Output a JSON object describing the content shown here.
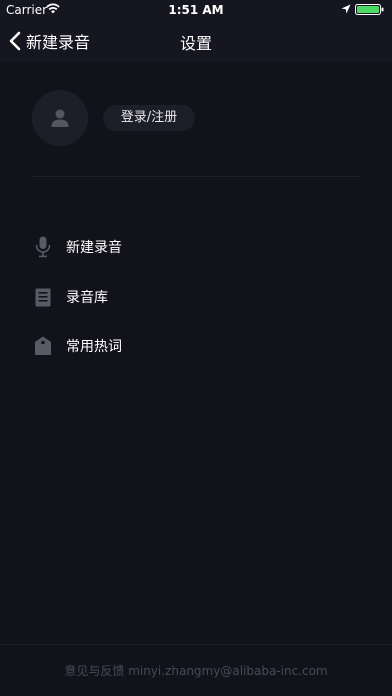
{
  "status_bar": {
    "carrier": "Carrier",
    "time": "1:51 AM",
    "icons": [
      "wifi-icon",
      "location-icon",
      "battery-icon"
    ],
    "battery_color": "#4cd964"
  },
  "nav": {
    "back_label": "新建录音",
    "title": "设置"
  },
  "profile": {
    "avatar_icon": "user-icon",
    "login_label": "登录/注册"
  },
  "menu": {
    "items": [
      {
        "label": "新建录音",
        "icon": "microphone-icon"
      },
      {
        "label": "录音库",
        "icon": "document-icon"
      },
      {
        "label": "常用热词",
        "icon": "tag-icon"
      }
    ]
  },
  "footer": {
    "text": "意见与反馈 minyi.zhangmy@alibaba-inc.com"
  },
  "colors": {
    "background": "#12121b",
    "bar_background": "#161620",
    "surface": "#1e1e28",
    "icon_gray": "#5a5a66",
    "footer_text": "#4a4a57"
  }
}
